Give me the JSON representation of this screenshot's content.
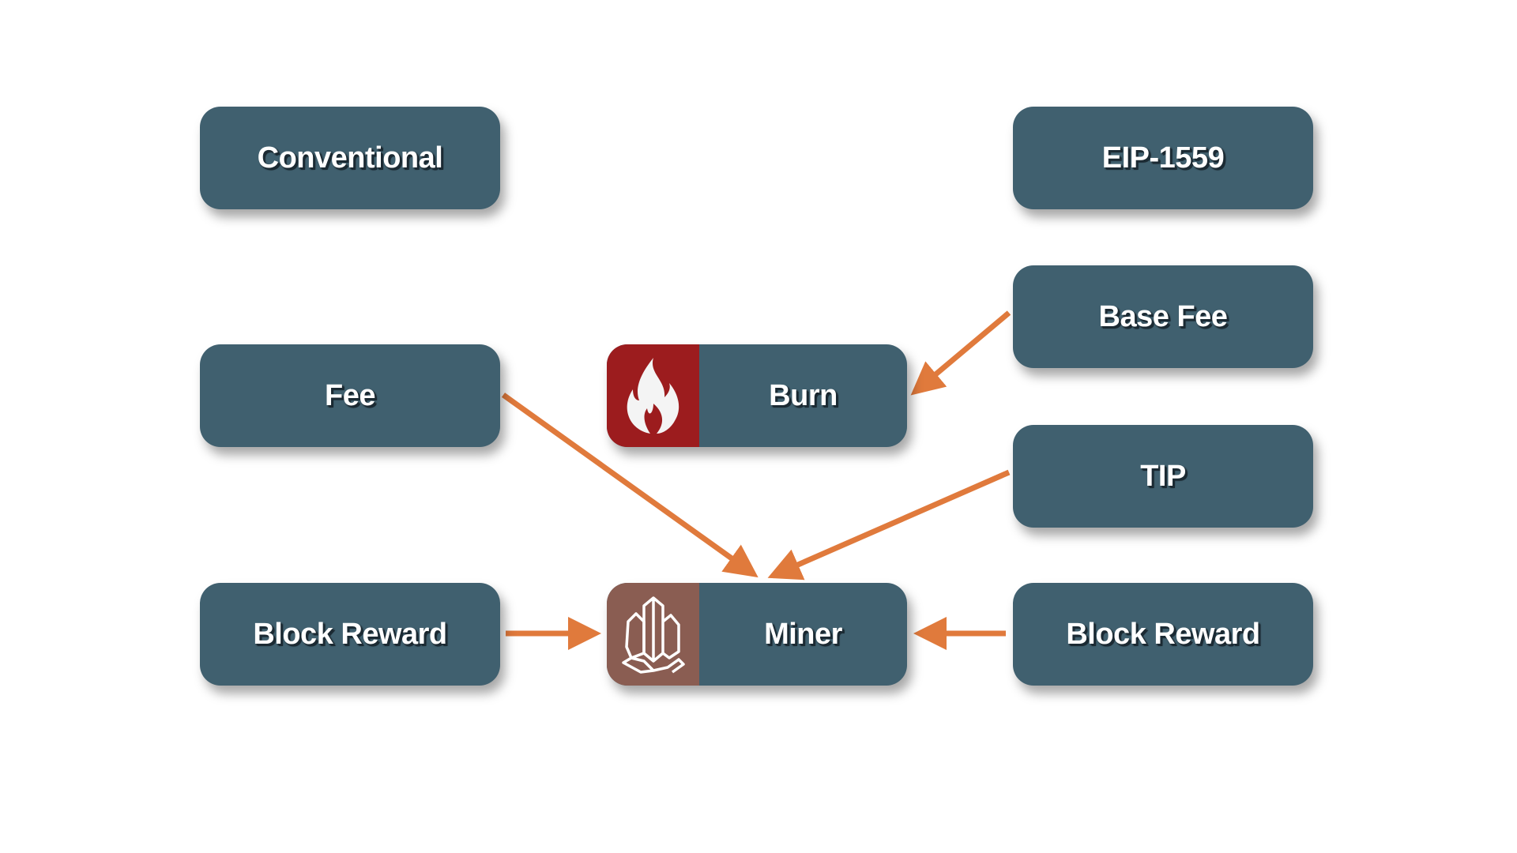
{
  "colors": {
    "box": "#40606f",
    "burn": "#9c1c1e",
    "miner": "#8a5d52",
    "arrow": "#e07a3c"
  },
  "left": {
    "header": "Conventional",
    "fee": "Fee",
    "block_reward": "Block Reward"
  },
  "middle": {
    "burn": "Burn",
    "burn_icon": "flame-icon",
    "miner": "Miner",
    "miner_icon": "crystal-icon"
  },
  "right": {
    "header": "EIP-1559",
    "base_fee": "Base Fee",
    "tip": "TIP",
    "block_reward": "Block Reward"
  }
}
